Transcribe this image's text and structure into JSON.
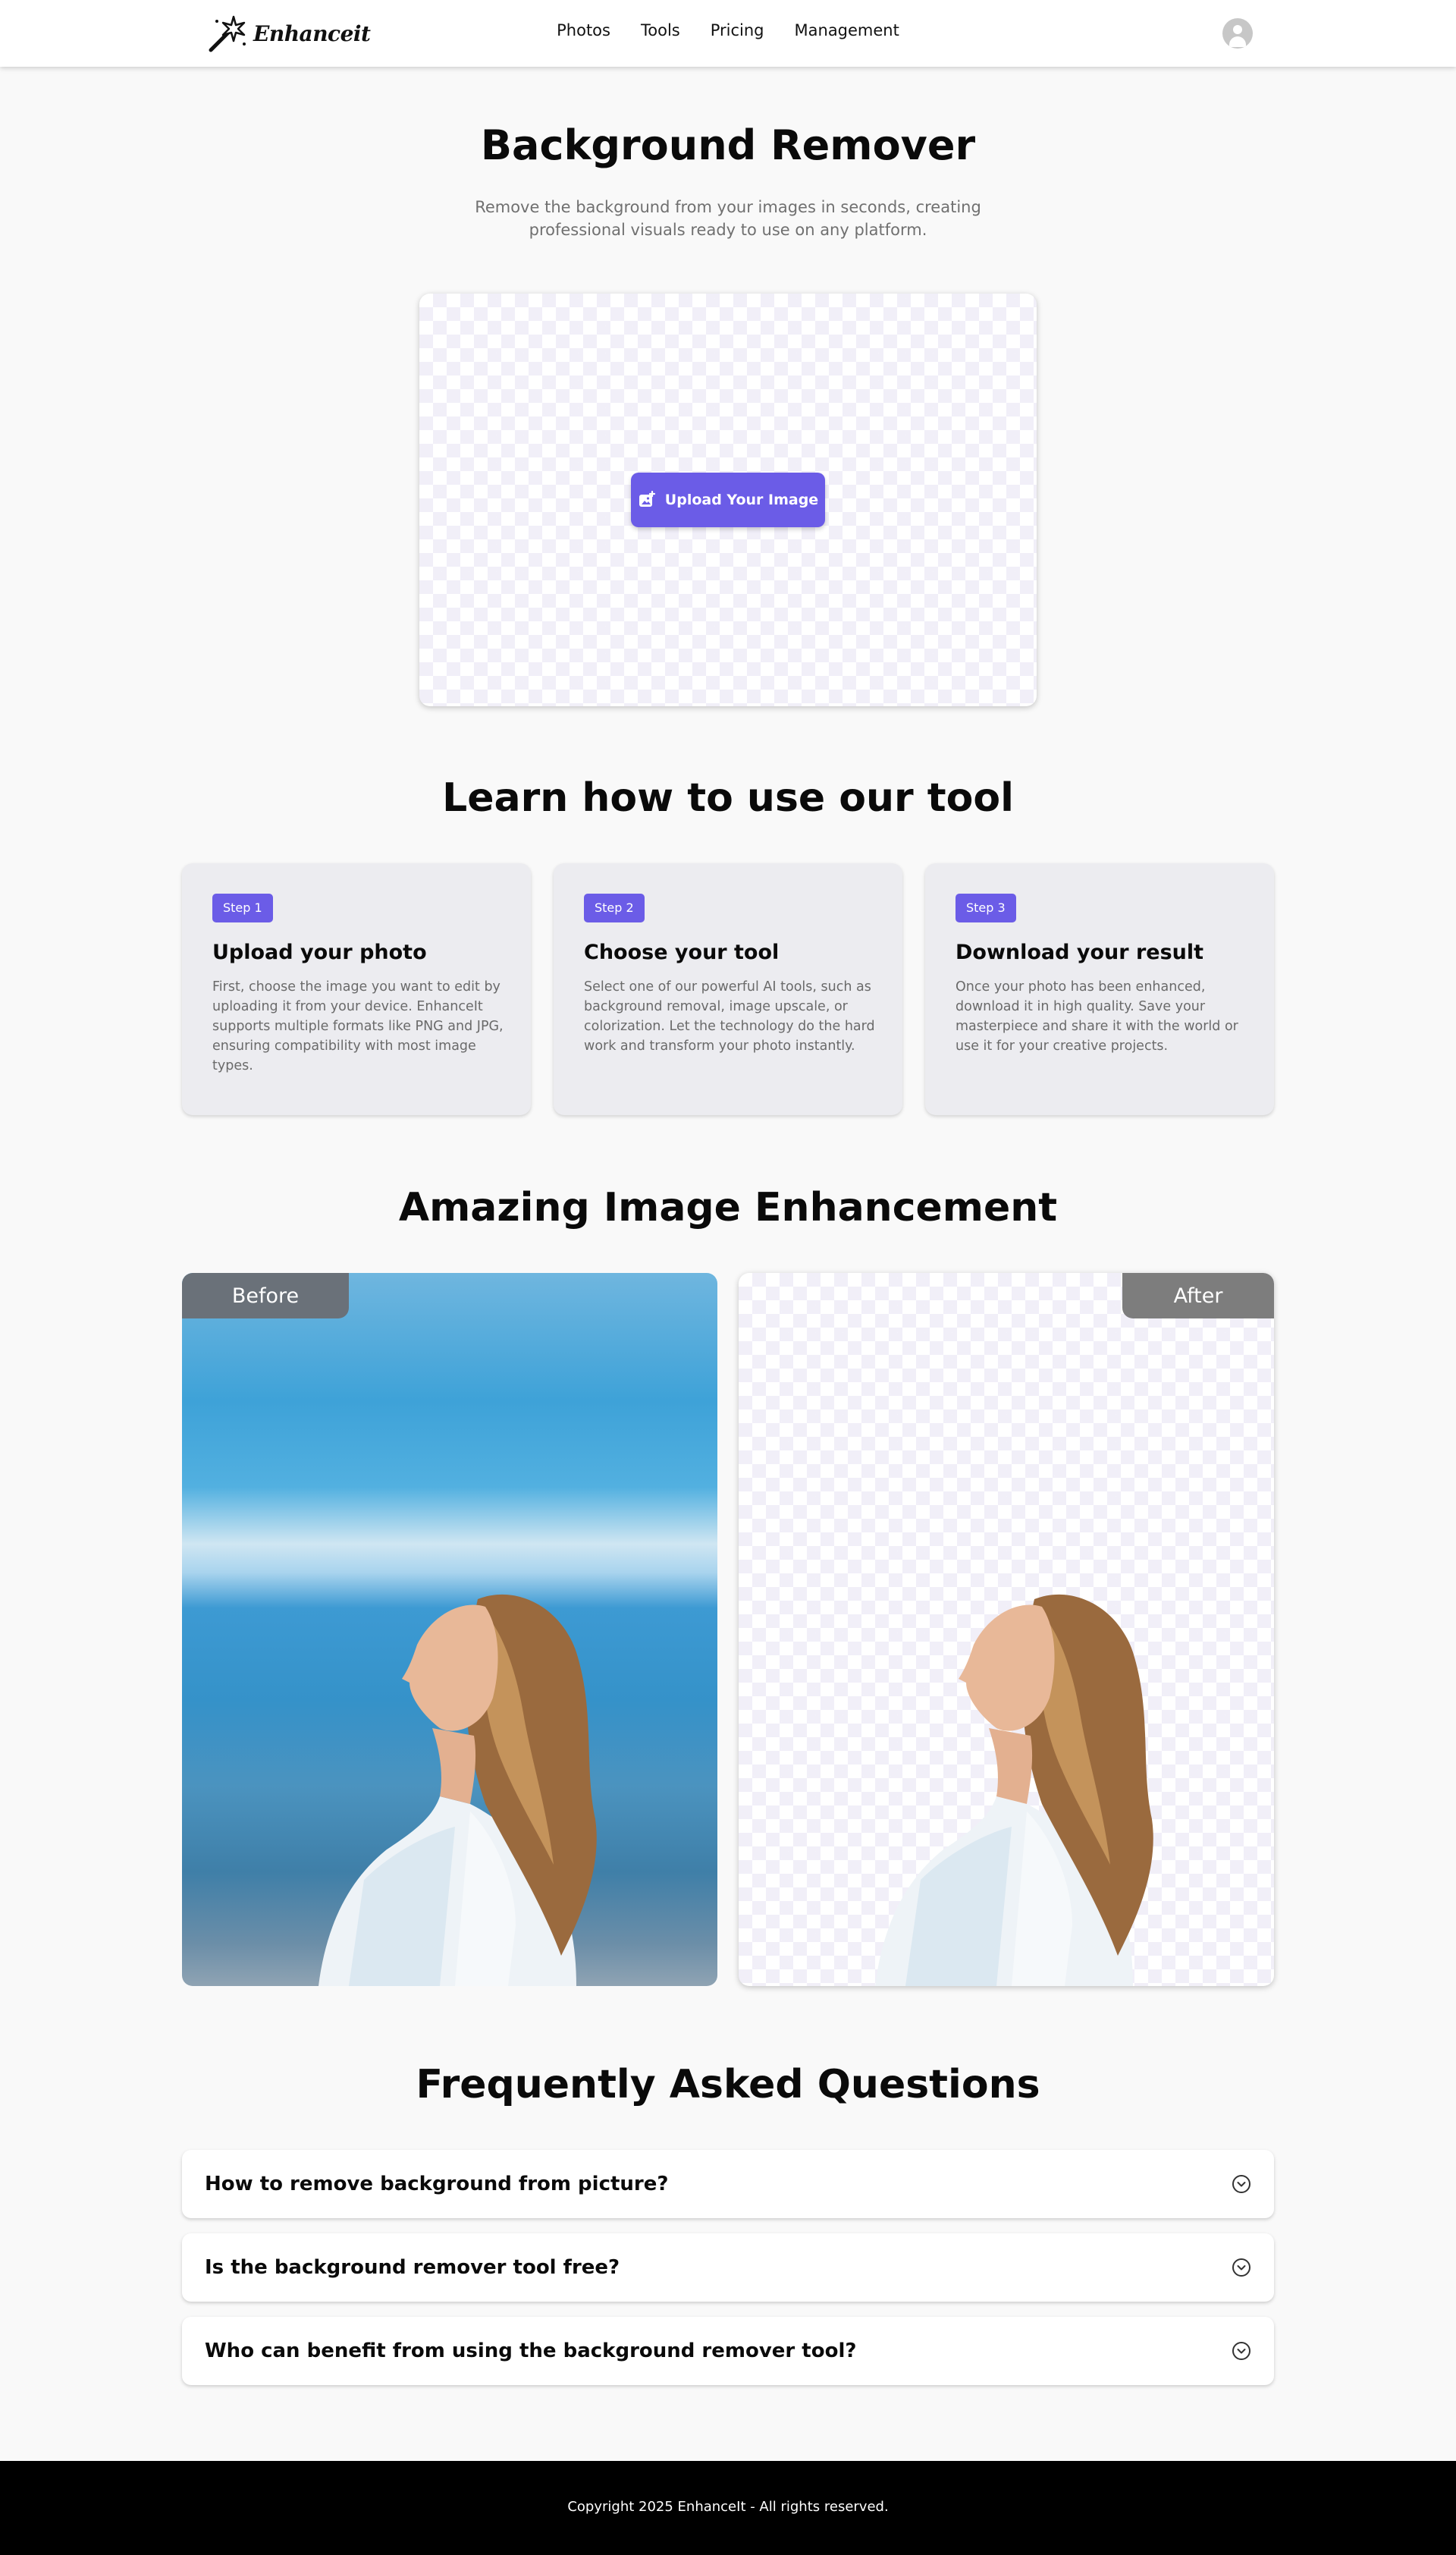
{
  "header": {
    "logo_text": "Enhanceit",
    "nav": [
      "Photos",
      "Tools",
      "Pricing",
      "Management"
    ],
    "avatar_icon": "user-icon"
  },
  "hero": {
    "title": "Background Remover",
    "subtitle": "Remove the background from your images in seconds, creating professional visuals ready to use on any platform.",
    "upload_label": "Upload Your Image",
    "upload_icon": "image-add-icon"
  },
  "steps": {
    "title": "Learn how to use our tool",
    "items": [
      {
        "badge": "Step 1",
        "title": "Upload your photo",
        "desc": "First, choose the image you want to edit by uploading it from your device. EnhanceIt supports multiple formats like PNG and JPG, ensuring compatibility with most image types."
      },
      {
        "badge": "Step 2",
        "title": "Choose your tool",
        "desc": "Select one of our powerful AI tools, such as background removal, image upscale, or colorization. Let the technology do the hard work and transform your photo instantly."
      },
      {
        "badge": "Step 3",
        "title": "Download your result",
        "desc": "Once your photo has been enhanced, download it in high quality. Save your masterpiece and share it with the world or use it for your creative projects."
      }
    ]
  },
  "compare": {
    "title": "Amazing Image Enhancement",
    "before_label": "Before",
    "after_label": "After"
  },
  "faq": {
    "title": "Frequently Asked Questions",
    "items": [
      "How to remove background from picture?",
      "Is the background remover tool free?",
      "Who can benefit from using the background remover tool?"
    ],
    "toggle_icon": "chevron-down-circle-icon"
  },
  "footer": {
    "copyright": "Copyright 2025 EnhanceIt - All rights reserved."
  },
  "colors": {
    "accent": "#6b5ce7",
    "footer_bg": "#000000"
  }
}
